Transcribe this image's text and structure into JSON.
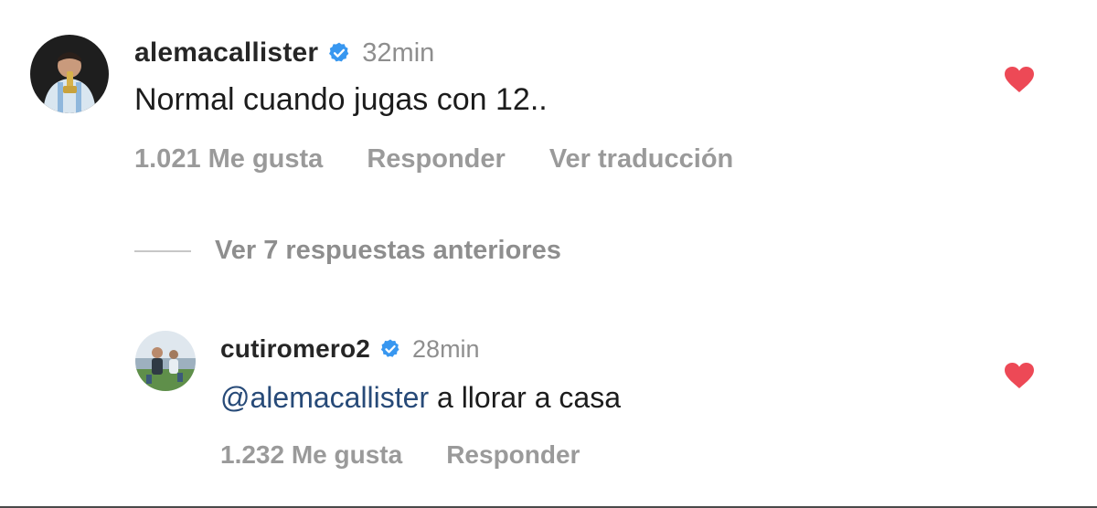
{
  "main_comment": {
    "username": "alemacallister",
    "time": "32min",
    "text": "Normal cuando jugas con 12..",
    "likes": "1.021 Me gusta",
    "reply_label": "Responder",
    "translate_label": "Ver traducción",
    "liked": true
  },
  "view_replies": {
    "label": "Ver 7 respuestas anteriores"
  },
  "reply_comment": {
    "username": "cutiromero2",
    "time": "28min",
    "mention": "@alemacallister",
    "text": " a llorar a casa",
    "likes": "1.232 Me gusta",
    "reply_label": "Responder",
    "liked": true
  },
  "colors": {
    "heart": "#ed4956",
    "verified": "#3897f0",
    "mention": "#274a78",
    "muted": "#8e8e8e"
  },
  "icons": {
    "verified": "verified-badge-icon",
    "like": "heart-icon"
  }
}
